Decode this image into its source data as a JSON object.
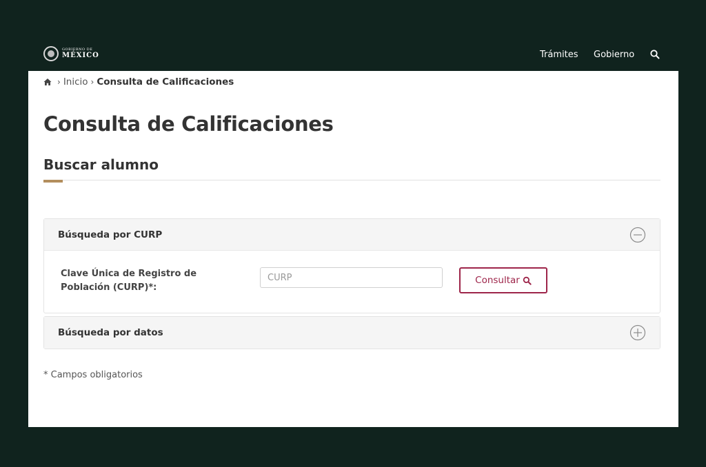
{
  "header": {
    "logo_line1": "GOBIERNO DE",
    "logo_line2": "MÉXICO",
    "nav": [
      {
        "label": "Trámites"
      },
      {
        "label": "Gobierno"
      }
    ],
    "search_icon": "search-icon"
  },
  "breadcrumb": {
    "home_icon": "home-icon",
    "items": [
      {
        "label": "Inicio"
      },
      {
        "label": "Consulta de Calificaciones"
      }
    ]
  },
  "page": {
    "title": "Consulta de Calificaciones",
    "section_title": "Buscar alumno"
  },
  "accordion": {
    "curp": {
      "title": "Búsqueda por CURP",
      "expanded": true,
      "field_label": "Clave Única de Registro de Población (CURP)*:",
      "input_value": "",
      "input_placeholder": "CURP",
      "button_label": "Consultar"
    },
    "datos": {
      "title": "Búsqueda por datos",
      "expanded": false
    }
  },
  "footnote": "* Campos obligatorios",
  "colors": {
    "background": "#10231e",
    "accent_gold": "#b38e5d",
    "accent_burgundy": "#9d2449"
  }
}
